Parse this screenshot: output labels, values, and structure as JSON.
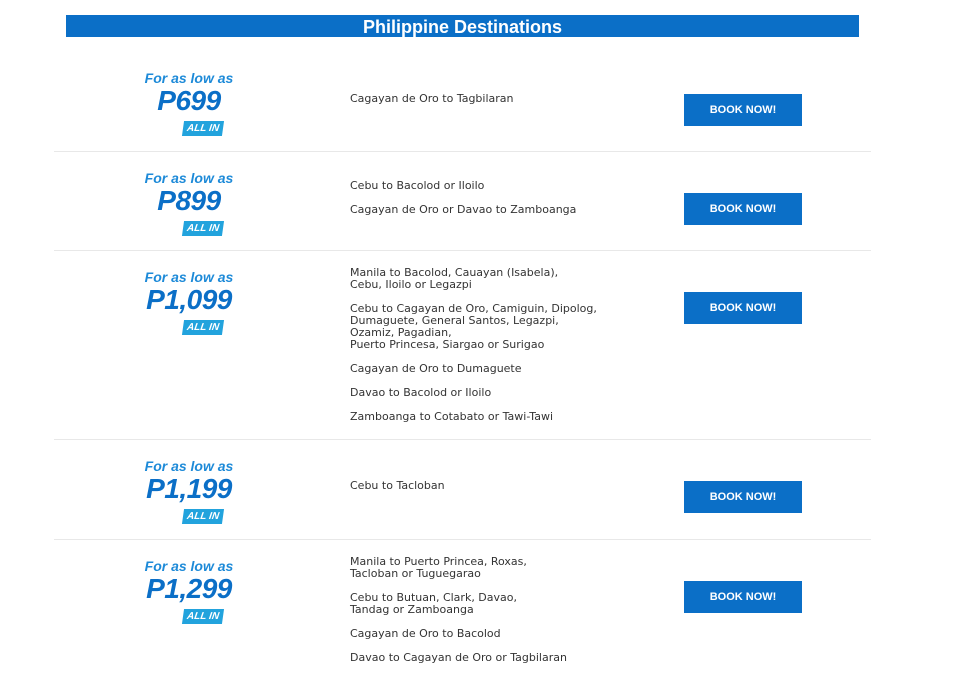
{
  "header": {
    "title": "Philippine Destinations"
  },
  "colors": {
    "brand_blue": "#0b6fc7",
    "light_blue": "#1d8ad8",
    "allin_blue": "#22a3dd",
    "route_text": "#333333"
  },
  "promos": [
    {
      "intro": "For as low as",
      "price": "P699",
      "badge": "ALL IN",
      "routes": [
        "Cagayan de Oro to Tagbilaran"
      ],
      "button": "BOOK NOW!"
    },
    {
      "intro": "For as low as",
      "price": "P899",
      "badge": "ALL IN",
      "routes": [
        "Cebu to Bacolod or Iloilo",
        "Cagayan de Oro or Davao to Zamboanga"
      ],
      "button": "BOOK NOW!"
    },
    {
      "intro": "For as low as",
      "price": "P1,099",
      "badge": "ALL IN",
      "routes": [
        "Manila to Bacolod, Cauayan (Isabela),\nCebu, Iloilo or Legazpi",
        "Cebu to Cagayan de Oro, Camiguin, Dipolog,\nDumaguete, General Santos, Legazpi,\nOzamiz, Pagadian,\nPuerto Princesa, Siargao or Surigao",
        "Cagayan de Oro to Dumaguete",
        "Davao to Bacolod or Iloilo",
        "Zamboanga to Cotabato or Tawi-Tawi"
      ],
      "button": "BOOK NOW!"
    },
    {
      "intro": "For as low as",
      "price": "P1,199",
      "badge": "ALL IN",
      "routes": [
        "Cebu to Tacloban"
      ],
      "button": "BOOK NOW!"
    },
    {
      "intro": "For as low as",
      "price": "P1,299",
      "badge": "ALL IN",
      "routes": [
        "Manila to Puerto Princea, Roxas,\nTacloban or Tuguegarao",
        "Cebu to Butuan, Clark, Davao,\nTandag or Zamboanga",
        "Cagayan de Oro to Bacolod",
        "Davao to Cagayan de Oro or Tagbilaran"
      ],
      "button": "BOOK NOW!"
    }
  ]
}
